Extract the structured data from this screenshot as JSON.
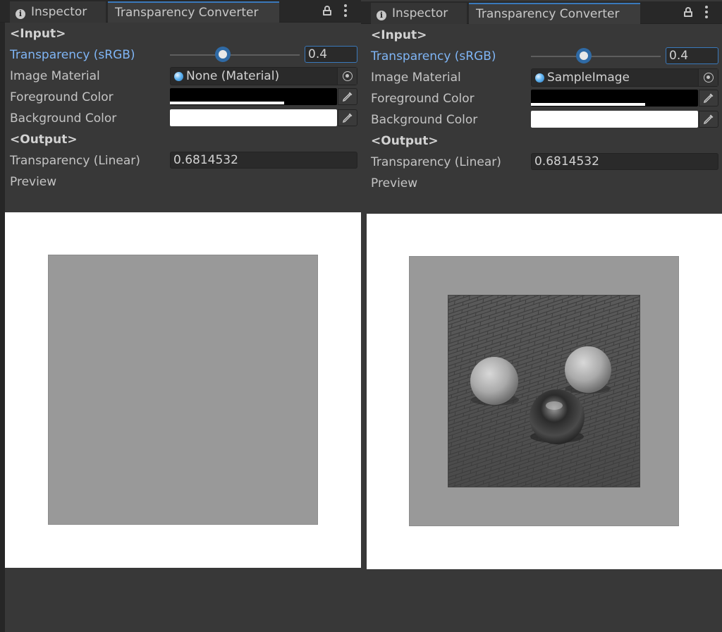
{
  "panels": [
    {
      "tabs": {
        "inspector": "Inspector",
        "converter": "Transparency Converter"
      },
      "input_heading": "<Input>",
      "transparency_srgb": {
        "label": "Transparency (sRGB)",
        "value": "0.4",
        "slider_fraction": 0.4
      },
      "image_material": {
        "label": "Image Material",
        "value": "None (Material)"
      },
      "foreground_color": {
        "label": "Foreground Color",
        "color": "#000000",
        "alpha_fraction": 0.68
      },
      "background_color": {
        "label": "Background Color",
        "color": "#ffffff"
      },
      "output_heading": "<Output>",
      "transparency_linear": {
        "label": "Transparency (Linear)",
        "value": "0.6814532"
      },
      "preview_label": "Preview",
      "preview": {
        "background": "#ffffff",
        "square_color": "#999999",
        "has_image": false
      }
    },
    {
      "tabs": {
        "inspector": "Inspector",
        "converter": "Transparency Converter"
      },
      "input_heading": "<Input>",
      "transparency_srgb": {
        "label": "Transparency (sRGB)",
        "value": "0.4",
        "slider_fraction": 0.4
      },
      "image_material": {
        "label": "Image Material",
        "value": "SampleImage"
      },
      "foreground_color": {
        "label": "Foreground Color",
        "color": "#000000",
        "alpha_fraction": 0.68
      },
      "background_color": {
        "label": "Background Color",
        "color": "#ffffff"
      },
      "output_heading": "<Output>",
      "transparency_linear": {
        "label": "Transparency (Linear)",
        "value": "0.6814532"
      },
      "preview_label": "Preview",
      "preview": {
        "background": "#ffffff",
        "square_color": "#999999",
        "has_image": true
      }
    }
  ],
  "icons": {
    "tab": "info-icon",
    "lock": "lock-icon",
    "menu": "kebab-menu-icon",
    "object": "material-sphere-icon",
    "picker": "object-picker-icon",
    "eyedropper": "eyedropper-icon"
  },
  "colors": {
    "accent": "#3a79bb",
    "active_label": "#7fb5f5",
    "panel_bg": "#383838"
  }
}
